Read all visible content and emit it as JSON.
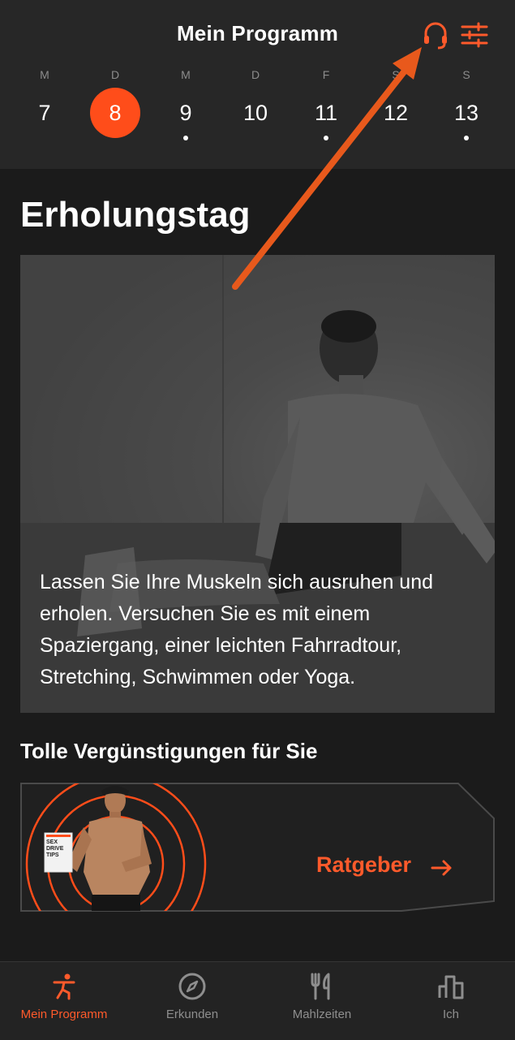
{
  "header": {
    "title": "Mein Programm",
    "icons": [
      "headset-icon",
      "sliders-icon"
    ]
  },
  "week": [
    {
      "letter": "M",
      "num": "7",
      "active": false,
      "dot": false
    },
    {
      "letter": "D",
      "num": "8",
      "active": true,
      "dot": false
    },
    {
      "letter": "M",
      "num": "9",
      "active": false,
      "dot": true
    },
    {
      "letter": "D",
      "num": "10",
      "active": false,
      "dot": false
    },
    {
      "letter": "F",
      "num": "11",
      "active": false,
      "dot": true
    },
    {
      "letter": "S",
      "num": "12",
      "active": false,
      "dot": false
    },
    {
      "letter": "S",
      "num": "13",
      "active": false,
      "dot": true
    }
  ],
  "main": {
    "section_title": "Erholungstag",
    "hero_text": "Lassen Sie Ihre Muskeln sich ausruhen und erholen. Versuchen Sie es mit einem Spaziergang, einer leichten Fahrradtour, Stretching, Schwimmen oder Yoga.",
    "offers_title": "Tolle Vergünstigungen für Sie",
    "promo": {
      "label": "Ratgeber",
      "book_text": "SEX DRIVE TIPS"
    }
  },
  "tabs": [
    {
      "label": "Mein Programm",
      "icon": "person-stretch-icon",
      "active": true
    },
    {
      "label": "Erkunden",
      "icon": "compass-icon",
      "active": false
    },
    {
      "label": "Mahlzeiten",
      "icon": "fork-knife-icon",
      "active": false
    },
    {
      "label": "Ich",
      "icon": "bar-chart-icon",
      "active": false
    }
  ],
  "colors": {
    "accent": "#ff4d1a",
    "background": "#1b1b1b",
    "header_bg": "#272727"
  }
}
